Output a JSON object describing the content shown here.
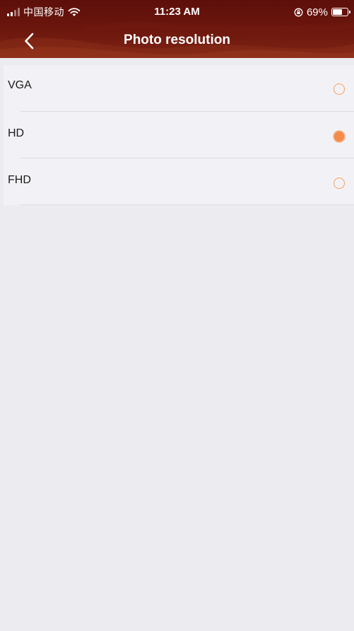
{
  "status_bar": {
    "carrier": "中国移动",
    "time": "11:23 AM",
    "battery_text": "69%",
    "battery_level": 0.69,
    "icons": [
      "signal-icon",
      "wifi-icon",
      "rotation-lock-icon",
      "battery-icon"
    ]
  },
  "nav": {
    "title": "Photo resolution",
    "back_icon": "chevron-left-icon"
  },
  "options": [
    {
      "label": "VGA",
      "selected": false
    },
    {
      "label": "HD",
      "selected": true
    },
    {
      "label": "FHD",
      "selected": false
    }
  ],
  "colors": {
    "header": "#6a150d",
    "accent": "#f48b4a",
    "background": "#ecebf0",
    "list_background": "#f2f2f6"
  }
}
